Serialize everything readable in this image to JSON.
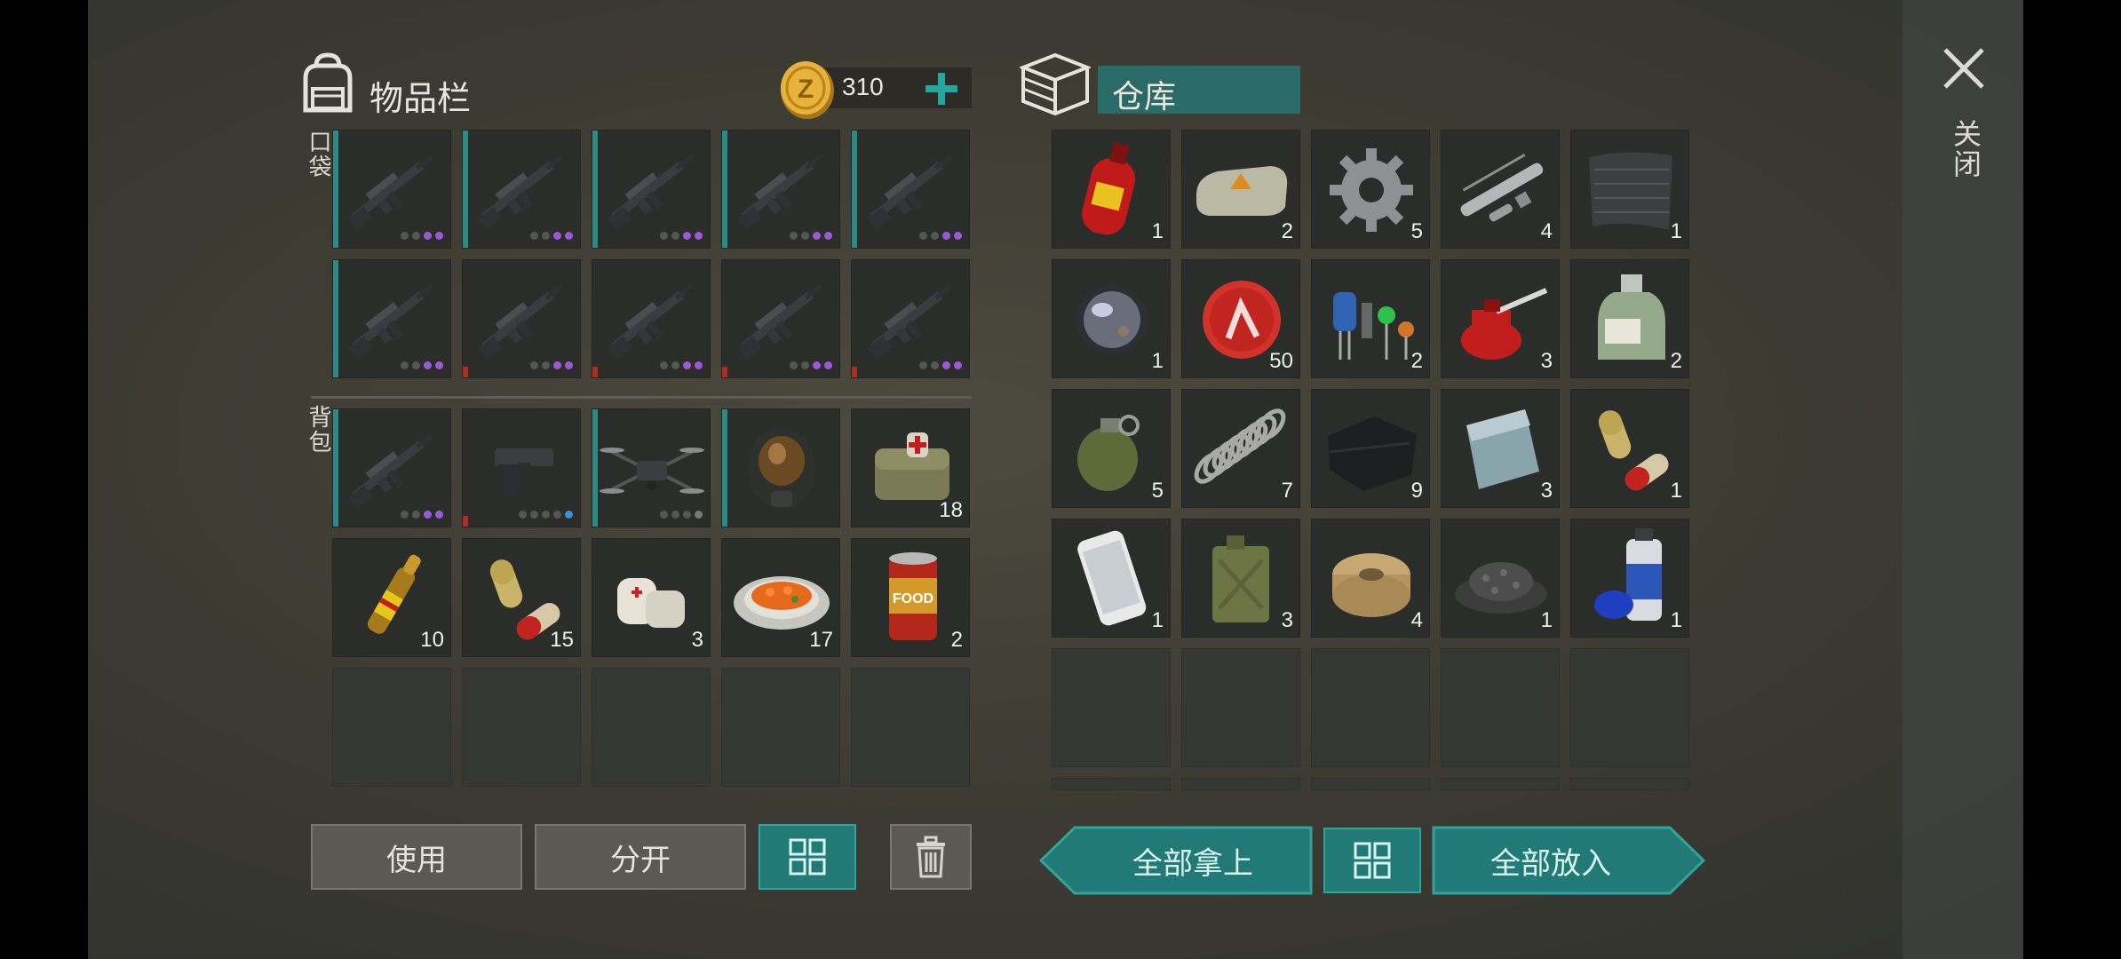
{
  "inventory": {
    "title": "物品栏",
    "coins": "310",
    "pocket_label": "口袋",
    "backpack_label": "背包",
    "pocket_slots": [
      {
        "icon": "assault-rifle-icon",
        "tag": "teal",
        "dots": [
          "#555",
          "#555",
          "#9b59d6",
          "#9b59d6"
        ]
      },
      {
        "icon": "assault-rifle-icon",
        "tag": "teal",
        "dots": [
          "#555",
          "#555",
          "#9b59d6",
          "#9b59d6"
        ]
      },
      {
        "icon": "assault-rifle-icon",
        "tag": "teal",
        "dots": [
          "#555",
          "#555",
          "#9b59d6",
          "#9b59d6"
        ]
      },
      {
        "icon": "assault-rifle-icon",
        "tag": "teal",
        "dots": [
          "#555",
          "#555",
          "#9b59d6",
          "#9b59d6"
        ]
      },
      {
        "icon": "assault-rifle-icon",
        "tag": "teal",
        "dots": [
          "#555",
          "#555",
          "#9b59d6",
          "#9b59d6"
        ]
      },
      {
        "icon": "assault-rifle-icon",
        "tag": "teal",
        "dots": [
          "#555",
          "#555",
          "#9b59d6",
          "#9b59d6"
        ]
      },
      {
        "icon": "assault-rifle-icon",
        "tag": "red",
        "dots": [
          "#555",
          "#555",
          "#9b59d6",
          "#9b59d6"
        ]
      },
      {
        "icon": "assault-rifle-icon",
        "tag": "red",
        "dots": [
          "#555",
          "#555",
          "#9b59d6",
          "#9b59d6"
        ]
      },
      {
        "icon": "assault-rifle-icon",
        "tag": "red",
        "dots": [
          "#555",
          "#555",
          "#9b59d6",
          "#9b59d6"
        ]
      },
      {
        "icon": "assault-rifle-icon",
        "tag": "red",
        "dots": [
          "#555",
          "#555",
          "#9b59d6",
          "#9b59d6"
        ]
      }
    ],
    "backpack_slots": [
      {
        "icon": "assault-rifle-icon",
        "tag": "teal",
        "dots": [
          "#555",
          "#555",
          "#9b59d6",
          "#9b59d6"
        ]
      },
      {
        "icon": "pistol-icon",
        "tag": "red",
        "dots": [
          "#555",
          "#555",
          "#555",
          "#555",
          "#3a8fd6"
        ]
      },
      {
        "icon": "drone-icon",
        "tag": "teal",
        "dots": [
          "#555",
          "#555",
          "#555",
          "#777"
        ]
      },
      {
        "icon": "gas-mask-icon",
        "tag": "teal"
      },
      {
        "icon": "medkit-bag-icon",
        "count": "18"
      },
      {
        "icon": "ampoule-icon",
        "count": "10"
      },
      {
        "icon": "pills-icon",
        "count": "15"
      },
      {
        "icon": "bandage-icon",
        "count": "3"
      },
      {
        "icon": "food-plate-icon",
        "count": "17"
      },
      {
        "icon": "food-can-icon",
        "count": "2"
      },
      {
        "icon": "empty"
      },
      {
        "icon": "empty"
      },
      {
        "icon": "empty"
      },
      {
        "icon": "empty"
      },
      {
        "icon": "empty"
      }
    ]
  },
  "storage": {
    "title": "仓库",
    "slots": [
      {
        "icon": "gas-cylinder-icon",
        "count": "1"
      },
      {
        "icon": "explosive-block-icon",
        "count": "2"
      },
      {
        "icon": "gear-icon",
        "count": "5"
      },
      {
        "icon": "gun-parts-icon",
        "count": "4"
      },
      {
        "icon": "mesh-fabric-icon",
        "count": "1"
      },
      {
        "icon": "lens-icon",
        "count": "1"
      },
      {
        "icon": "bottle-cap-icon",
        "count": "50"
      },
      {
        "icon": "electronic-components-icon",
        "count": "2"
      },
      {
        "icon": "oil-can-icon",
        "count": "3"
      },
      {
        "icon": "chemical-bottle-icon",
        "count": "2"
      },
      {
        "icon": "grenade-icon",
        "count": "5"
      },
      {
        "icon": "spring-icon",
        "count": "7"
      },
      {
        "icon": "cloth-icon",
        "count": "9"
      },
      {
        "icon": "metal-plate-icon",
        "count": "3"
      },
      {
        "icon": "pills-icon",
        "count": "1"
      },
      {
        "icon": "smartphone-icon",
        "count": "1"
      },
      {
        "icon": "jerrycan-icon",
        "count": "3"
      },
      {
        "icon": "wire-spool-icon",
        "count": "4"
      },
      {
        "icon": "gravel-pile-icon",
        "count": "1"
      },
      {
        "icon": "spray-paint-icon",
        "count": "1"
      }
    ]
  },
  "buttons": {
    "use": "使用",
    "split": "分开",
    "take_all": "全部拿上",
    "put_all": "全部放入"
  },
  "close_label": "关闭",
  "colors": {
    "teal": "#2a8a86",
    "red": "#b32a1e",
    "accent": "#21a097"
  }
}
